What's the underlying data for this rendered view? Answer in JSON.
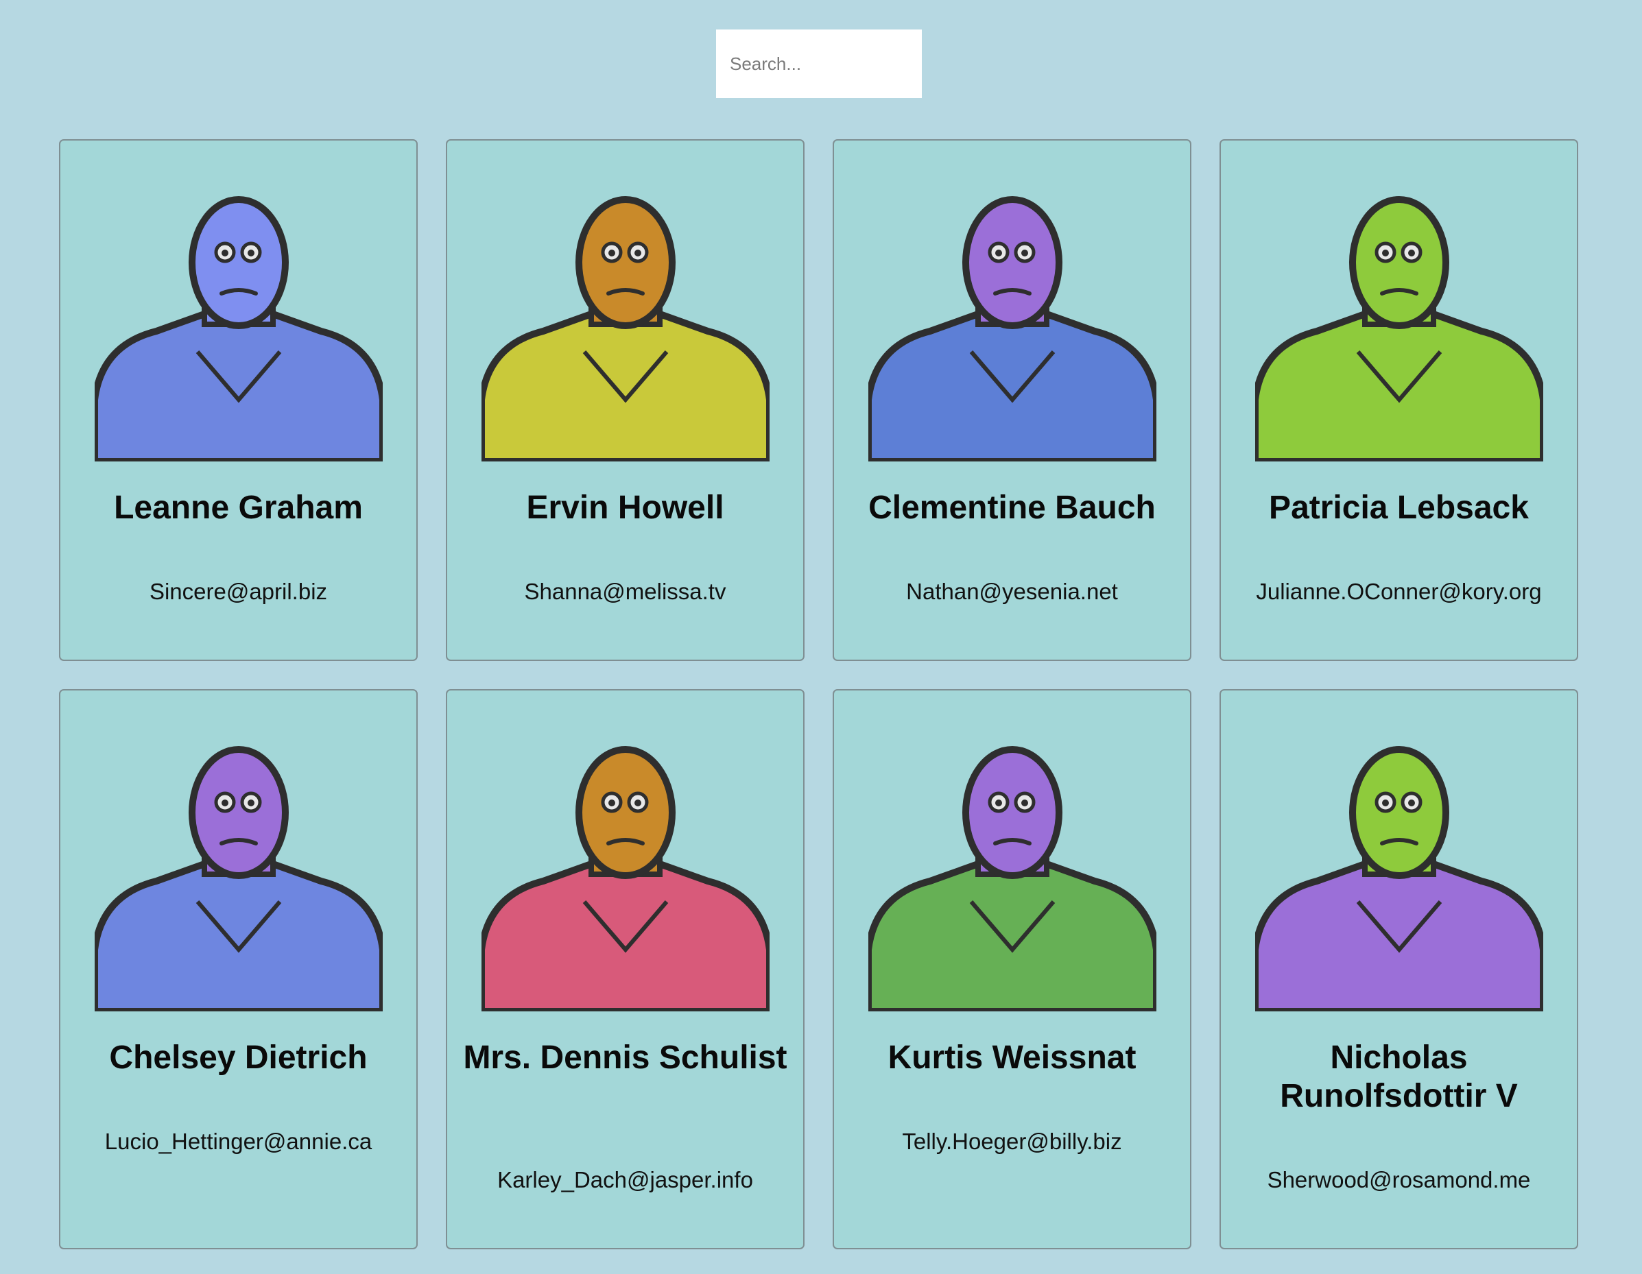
{
  "search": {
    "placeholder": "Search..."
  },
  "colors": {
    "background": "#b6d8e2",
    "card": "#a3d7d8",
    "card_border": "#7f8f93"
  },
  "cards": [
    {
      "name": "Leanne Graham",
      "email": "Sincere@april.biz",
      "avatar": "blue-monster-robot-icon",
      "head_color": "#7f8ff0",
      "body_color": "#6e86e0"
    },
    {
      "name": "Ervin Howell",
      "email": "Shanna@melissa.tv",
      "avatar": "orange-monster-robot-icon",
      "head_color": "#c98a2a",
      "body_color": "#c9c93a"
    },
    {
      "name": "Clementine Bauch",
      "email": "Nathan@yesenia.net",
      "avatar": "purple-cyclops-robot-icon",
      "head_color": "#9b6fd8",
      "body_color": "#5d7fd6"
    },
    {
      "name": "Patricia Lebsack",
      "email": "Julianne.OConner@kory.org",
      "avatar": "green-helmet-robot-icon",
      "head_color": "#8ecb3c",
      "body_color": "#8ecb3c"
    },
    {
      "name": "Chelsey Dietrich",
      "email": "Lucio_Hettinger@annie.ca",
      "avatar": "purple-helmet-robot-icon",
      "head_color": "#9b6fd8",
      "body_color": "#6e86e0"
    },
    {
      "name": "Mrs. Dennis Schulist",
      "email": "Karley_Dach@jasper.info",
      "avatar": "orange-antenna-robot-icon",
      "head_color": "#c98a2a",
      "body_color": "#d85a7a"
    },
    {
      "name": "Kurtis Weissnat",
      "email": "Telly.Hoeger@billy.biz",
      "avatar": "purple-horn-robot-icon",
      "head_color": "#9b6fd8",
      "body_color": "#66b055"
    },
    {
      "name": "Nicholas Runolfsdottir V",
      "email": "Sherwood@rosamond.me",
      "avatar": "green-cyclops-robot-icon",
      "head_color": "#8ecb3c",
      "body_color": "#9b6fd8"
    }
  ]
}
